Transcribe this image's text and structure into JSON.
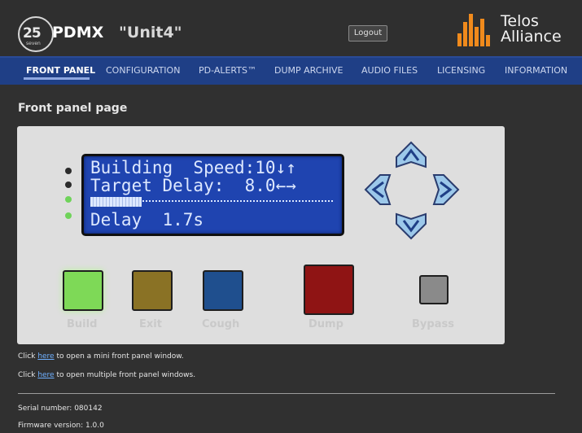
{
  "header": {
    "logo_number": "25",
    "logo_subtext": "seven",
    "product": "PDMX",
    "unit_name": "\"Unit4\"",
    "logout_label": "Logout",
    "brand_line1": "Telos",
    "brand_line2": "Alliance"
  },
  "nav": {
    "items": [
      {
        "label": "FRONT PANEL",
        "active": true
      },
      {
        "label": "CONFIGURATION",
        "active": false
      },
      {
        "label": "PD-ALERTS™",
        "active": false
      },
      {
        "label": "DUMP ARCHIVE",
        "active": false
      },
      {
        "label": "AUDIO FILES",
        "active": false
      },
      {
        "label": "LICENSING",
        "active": false
      },
      {
        "label": "INFORMATION",
        "active": false
      }
    ]
  },
  "page": {
    "title": "Front panel page"
  },
  "lcd": {
    "line1": "Building  Speed:10↓↑",
    "line2": "Target Delay:  8.0←→",
    "line3": "Delay  1.7s",
    "progress": 0.21
  },
  "leds": [
    {
      "state": "on",
      "color": "#2b2b2b"
    },
    {
      "state": "on",
      "color": "#2b2b2b"
    },
    {
      "state": "green",
      "color": "#6fd35a"
    },
    {
      "state": "green",
      "color": "#6fd35a"
    }
  ],
  "buttons": [
    {
      "label": "Build",
      "color": "#7ed957"
    },
    {
      "label": "Exit",
      "color": "#8a7225"
    },
    {
      "label": "Cough",
      "color": "#1f4f8e"
    },
    {
      "label": "Dump",
      "color": "#8f1414"
    },
    {
      "label": "Bypass",
      "color": "#8a8a8a"
    }
  ],
  "arrows": {
    "up": "arrow-up-icon",
    "down": "arrow-down-icon",
    "left": "arrow-left-icon",
    "right": "arrow-right-icon"
  },
  "links": {
    "line1_prefix": "Click ",
    "line1_link": "here",
    "line1_suffix": " to open a mini front panel window.",
    "line2_prefix": "Click ",
    "line2_link": "here",
    "line2_suffix": " to open multiple front panel windows."
  },
  "info": {
    "serial": "Serial number: 080142",
    "firmware": "Firmware version: 1.0.0"
  },
  "colors": {
    "nav": "#1f3f86",
    "lcd": "#1f44b0",
    "panel": "#dedede",
    "arrow": "#9cc8ea"
  }
}
